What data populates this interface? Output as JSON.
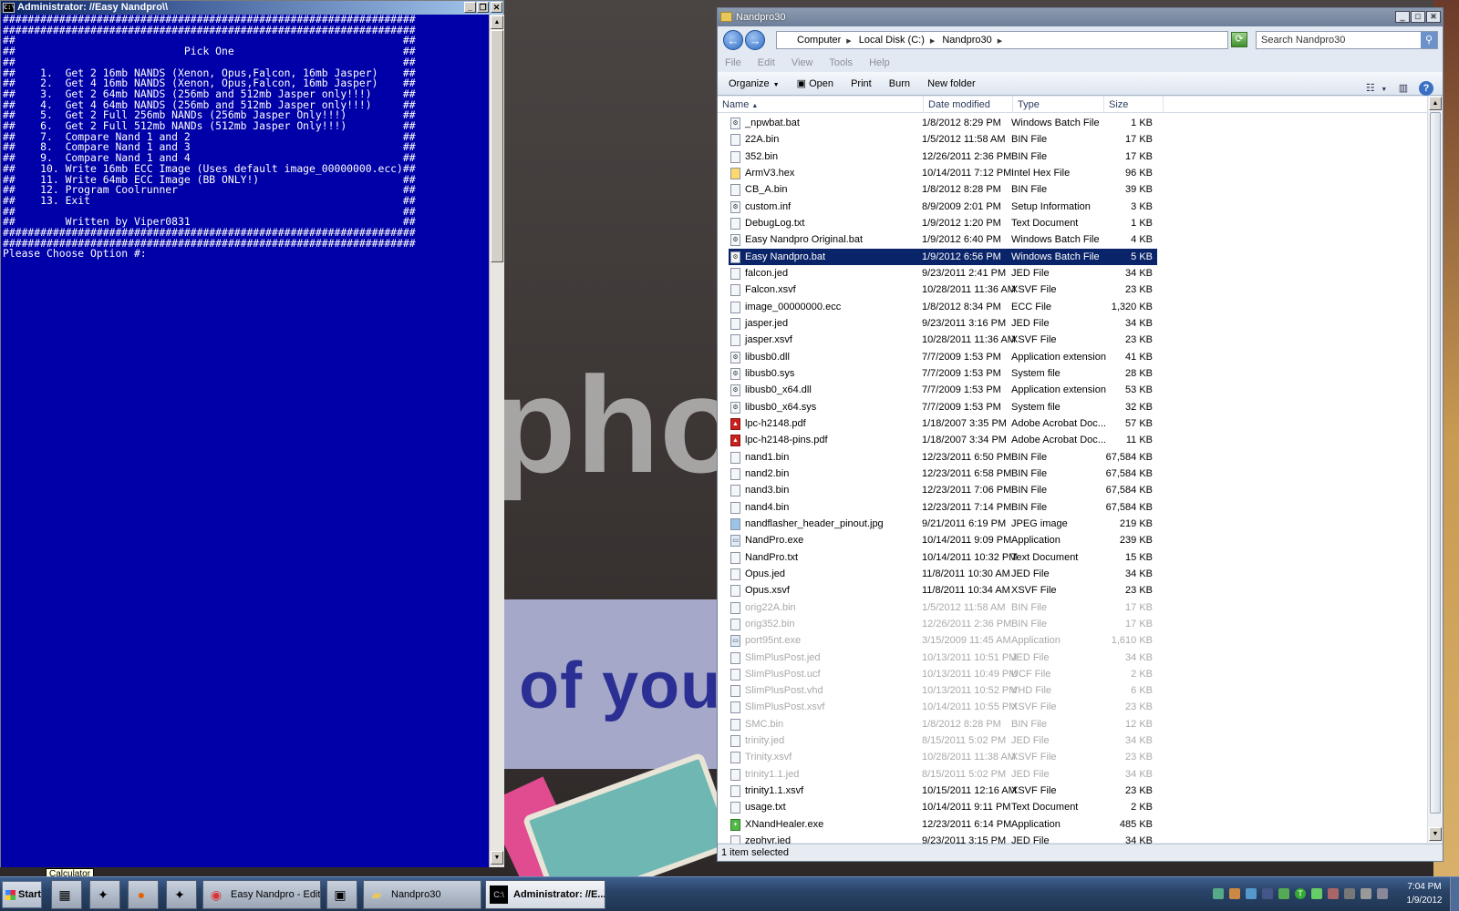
{
  "wallpaper": {
    "watermark_text": "Protect more of your",
    "watermark_photo": "phot"
  },
  "console": {
    "title": "Administrator:  //Easy Nandpro\\\\",
    "cmd_icon": "C:\\",
    "lines": [
      "##################################################################",
      "##################################################################",
      "##                                                              ##",
      "##                           Pick One                           ##",
      "##                                                              ##",
      "##    1.  Get 2 16mb NANDS (Xenon, Opus,Falcon, 16mb Jasper)    ##",
      "##    2.  Get 4 16mb NANDS (Xenon, Opus,Falcon, 16mb Jasper)    ##",
      "##    3.  Get 2 64mb NANDS (256mb and 512mb Jasper only!!!)     ##",
      "##    4.  Get 4 64mb NANDS (256mb and 512mb Jasper only!!!)     ##",
      "##    5.  Get 2 Full 256mb NANDs (256mb Jasper Only!!!)         ##",
      "##    6.  Get 2 Full 512mb NANDs (512mb Jasper Only!!!)         ##",
      "##    7.  Compare Nand 1 and 2                                  ##",
      "##    8.  Compare Nand 1 and 3                                  ##",
      "##    9.  Compare Nand 1 and 4                                  ##",
      "##    10. Write 16mb ECC Image (Uses default image_00000000.ecc)##",
      "##    11. Write 64mb ECC Image (BB ONLY!)                       ##",
      "##    12. Program Coolrunner                                    ##",
      "##    13. Exit                                                  ##",
      "##                                                              ##",
      "##        Written by Viper0831                                  ##",
      "##################################################################",
      "##################################################################",
      "Please Choose Option #:"
    ]
  },
  "explorer": {
    "title": "Nandpro30",
    "breadcrumb": [
      "Computer",
      "Local Disk (C:)",
      "Nandpro30"
    ],
    "search_placeholder": "Search Nandpro30",
    "menu": [
      "File",
      "Edit",
      "View",
      "Tools",
      "Help"
    ],
    "commands": {
      "organize": "Organize",
      "open": "Open",
      "print": "Print",
      "burn": "Burn",
      "new_folder": "New folder"
    },
    "columns": {
      "name": "Name",
      "date": "Date modified",
      "type": "Type",
      "size": "Size"
    },
    "files": [
      {
        "name": "_npwbat.bat",
        "date": "1/8/2012 8:29 PM",
        "type": "Windows Batch File",
        "size": "1 KB",
        "icon": "bat-icon"
      },
      {
        "name": "22A.bin",
        "date": "1/5/2012 11:58 AM",
        "type": "BIN File",
        "size": "17 KB",
        "icon": "file-icon"
      },
      {
        "name": "352.bin",
        "date": "12/26/2011 2:36 PM",
        "type": "BIN File",
        "size": "17 KB",
        "icon": "file-icon"
      },
      {
        "name": "ArmV3.hex",
        "date": "10/14/2011 7:12 PM",
        "type": "Intel Hex File",
        "size": "96 KB",
        "icon": "hex-icon"
      },
      {
        "name": "CB_A.bin",
        "date": "1/8/2012 8:28 PM",
        "type": "BIN File",
        "size": "39 KB",
        "icon": "file-icon"
      },
      {
        "name": "custom.inf",
        "date": "8/9/2009 2:01 PM",
        "type": "Setup Information",
        "size": "3 KB",
        "icon": "inf-icon"
      },
      {
        "name": "DebugLog.txt",
        "date": "1/9/2012 1:20 PM",
        "type": "Text Document",
        "size": "1 KB",
        "icon": "file-icon"
      },
      {
        "name": "Easy Nandpro Original.bat",
        "date": "1/9/2012 6:40 PM",
        "type": "Windows Batch File",
        "size": "4 KB",
        "icon": "bat-icon"
      },
      {
        "name": "Easy Nandpro.bat",
        "date": "1/9/2012 6:56 PM",
        "type": "Windows Batch File",
        "size": "5 KB",
        "icon": "bat-icon",
        "selected": true
      },
      {
        "name": "falcon.jed",
        "date": "9/23/2011 2:41 PM",
        "type": "JED File",
        "size": "34 KB",
        "icon": "file-icon"
      },
      {
        "name": "Falcon.xsvf",
        "date": "10/28/2011 11:36 AM",
        "type": "XSVF File",
        "size": "23 KB",
        "icon": "file-icon"
      },
      {
        "name": "image_00000000.ecc",
        "date": "1/8/2012 8:34 PM",
        "type": "ECC File",
        "size": "1,320 KB",
        "icon": "file-icon"
      },
      {
        "name": "jasper.jed",
        "date": "9/23/2011 3:16 PM",
        "type": "JED File",
        "size": "34 KB",
        "icon": "file-icon"
      },
      {
        "name": "jasper.xsvf",
        "date": "10/28/2011 11:36 AM",
        "type": "XSVF File",
        "size": "23 KB",
        "icon": "file-icon"
      },
      {
        "name": "libusb0.dll",
        "date": "7/7/2009 1:53 PM",
        "type": "Application extension",
        "size": "41 KB",
        "icon": "dll-icon"
      },
      {
        "name": "libusb0.sys",
        "date": "7/7/2009 1:53 PM",
        "type": "System file",
        "size": "28 KB",
        "icon": "dll-icon"
      },
      {
        "name": "libusb0_x64.dll",
        "date": "7/7/2009 1:53 PM",
        "type": "Application extension",
        "size": "53 KB",
        "icon": "dll-icon"
      },
      {
        "name": "libusb0_x64.sys",
        "date": "7/7/2009 1:53 PM",
        "type": "System file",
        "size": "32 KB",
        "icon": "dll-icon"
      },
      {
        "name": "lpc-h2148.pdf",
        "date": "1/18/2007 3:35 PM",
        "type": "Adobe Acrobat Doc...",
        "size": "57 KB",
        "icon": "pdf-icon"
      },
      {
        "name": "lpc-h2148-pins.pdf",
        "date": "1/18/2007 3:34 PM",
        "type": "Adobe Acrobat Doc...",
        "size": "11 KB",
        "icon": "pdf-icon"
      },
      {
        "name": "nand1.bin",
        "date": "12/23/2011 6:50 PM",
        "type": "BIN File",
        "size": "67,584 KB",
        "icon": "file-icon"
      },
      {
        "name": "nand2.bin",
        "date": "12/23/2011 6:58 PM",
        "type": "BIN File",
        "size": "67,584 KB",
        "icon": "file-icon"
      },
      {
        "name": "nand3.bin",
        "date": "12/23/2011 7:06 PM",
        "type": "BIN File",
        "size": "67,584 KB",
        "icon": "file-icon"
      },
      {
        "name": "nand4.bin",
        "date": "12/23/2011 7:14 PM",
        "type": "BIN File",
        "size": "67,584 KB",
        "icon": "file-icon"
      },
      {
        "name": "nandflasher_header_pinout.jpg",
        "date": "9/21/2011 6:19 PM",
        "type": "JPEG image",
        "size": "219 KB",
        "icon": "image-icon"
      },
      {
        "name": "NandPro.exe",
        "date": "10/14/2011 9:09 PM",
        "type": "Application",
        "size": "239 KB",
        "icon": "app-icon"
      },
      {
        "name": "NandPro.txt",
        "date": "10/14/2011 10:32 PM",
        "type": "Text Document",
        "size": "15 KB",
        "icon": "file-icon"
      },
      {
        "name": "Opus.jed",
        "date": "11/8/2011 10:30 AM",
        "type": "JED File",
        "size": "34 KB",
        "icon": "file-icon"
      },
      {
        "name": "Opus.xsvf",
        "date": "11/8/2011 10:34 AM",
        "type": "XSVF File",
        "size": "23 KB",
        "icon": "file-icon"
      },
      {
        "name": "orig22A.bin",
        "date": "1/5/2012 11:58 AM",
        "type": "BIN File",
        "size": "17 KB",
        "icon": "file-icon",
        "dim": true
      },
      {
        "name": "orig352.bin",
        "date": "12/26/2011 2:36 PM",
        "type": "BIN File",
        "size": "17 KB",
        "icon": "file-icon",
        "dim": true
      },
      {
        "name": "port95nt.exe",
        "date": "3/15/2009 11:45 AM",
        "type": "Application",
        "size": "1,610 KB",
        "icon": "app-icon",
        "dim": true
      },
      {
        "name": "SlimPlusPost.jed",
        "date": "10/13/2011 10:51 PM",
        "type": "JED File",
        "size": "34 KB",
        "icon": "file-icon",
        "dim": true
      },
      {
        "name": "SlimPlusPost.ucf",
        "date": "10/13/2011 10:49 PM",
        "type": "UCF File",
        "size": "2 KB",
        "icon": "file-icon",
        "dim": true
      },
      {
        "name": "SlimPlusPost.vhd",
        "date": "10/13/2011 10:52 PM",
        "type": "VHD File",
        "size": "6 KB",
        "icon": "file-icon",
        "dim": true
      },
      {
        "name": "SlimPlusPost.xsvf",
        "date": "10/14/2011 10:55 PM",
        "type": "XSVF File",
        "size": "23 KB",
        "icon": "file-icon",
        "dim": true
      },
      {
        "name": "SMC.bin",
        "date": "1/8/2012 8:28 PM",
        "type": "BIN File",
        "size": "12 KB",
        "icon": "file-icon",
        "dim": true
      },
      {
        "name": "trinity.jed",
        "date": "8/15/2011 5:02 PM",
        "type": "JED File",
        "size": "34 KB",
        "icon": "file-icon",
        "dim": true
      },
      {
        "name": "Trinity.xsvf",
        "date": "10/28/2011 11:38 AM",
        "type": "XSVF File",
        "size": "23 KB",
        "icon": "file-icon",
        "dim": true
      },
      {
        "name": "trinity1.1.jed",
        "date": "8/15/2011 5:02 PM",
        "type": "JED File",
        "size": "34 KB",
        "icon": "file-icon",
        "dim": true
      },
      {
        "name": "trinity1.1.xsvf",
        "date": "10/15/2011 12:16 AM",
        "type": "XSVF File",
        "size": "23 KB",
        "icon": "file-icon"
      },
      {
        "name": "usage.txt",
        "date": "10/14/2011 9:11 PM",
        "type": "Text Document",
        "size": "2 KB",
        "icon": "file-icon"
      },
      {
        "name": "XNandHealer.exe",
        "date": "12/23/2011 6:14 PM",
        "type": "Application",
        "size": "485 KB",
        "icon": "plus-icon"
      },
      {
        "name": "zephyr.jed",
        "date": "9/23/2011 3:15 PM",
        "type": "JED File",
        "size": "34 KB",
        "icon": "file-icon"
      }
    ],
    "status": "1 item selected"
  },
  "taskbar": {
    "start_label": "Start",
    "tooltip": "Calculator",
    "buttons": [
      {
        "label": "Easy Nandpro - Edit P...",
        "icon": "chrome-icon"
      },
      {
        "label": "Nandpro30",
        "icon": "folder-icon"
      },
      {
        "label": "Administrator:  //E...",
        "icon": "console-icon",
        "active": true
      }
    ],
    "time": "7:04 PM",
    "date": "1/9/2012"
  }
}
